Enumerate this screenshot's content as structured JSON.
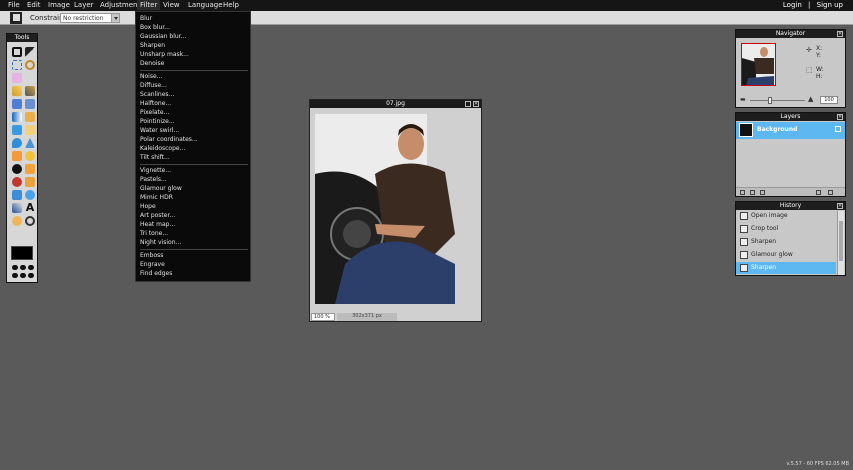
{
  "menubar": {
    "items": [
      "File",
      "Edit",
      "Image",
      "Layer",
      "Adjustment",
      "Filter",
      "View",
      "Language",
      "Help"
    ],
    "login": "Login",
    "separator": "|",
    "signup": "Sign up"
  },
  "toolbar": {
    "constraint_label": "Constraint:",
    "constraint_value": "No restriction"
  },
  "filter_menu": {
    "groups": [
      [
        "Blur",
        "Box blur...",
        "Gaussian blur...",
        "Sharpen",
        "Unsharp mask...",
        "Denoise"
      ],
      [
        "Noise...",
        "Diffuse...",
        "Scanlines...",
        "Halftone...",
        "Pixelate...",
        "Pointinize...",
        "Water swirl...",
        "Polar coordinates...",
        "Kaleidoscope...",
        "Tilt shift..."
      ],
      [
        "Vignette...",
        "Pastels...",
        "Glamour glow",
        "Mimic HDR",
        "Hope",
        "Art poster...",
        "Heat map...",
        "Tri tone...",
        "Night vision..."
      ],
      [
        "Emboss",
        "Engrave",
        "Find edges"
      ]
    ]
  },
  "tools_panel": {
    "title": "Tools"
  },
  "image_window": {
    "title": "07.jpg",
    "zoom": "100 %",
    "size": "302x371 px"
  },
  "navigator": {
    "title": "Navigator",
    "x_label": "X:",
    "y_label": "Y:",
    "w_label": "W:",
    "h_label": "H:",
    "zoom_value": "100"
  },
  "layers": {
    "title": "Layers",
    "items": [
      {
        "name": "Background"
      }
    ]
  },
  "history": {
    "title": "History",
    "items": [
      "Open image",
      "Crop tool",
      "Sharpen",
      "Glamour glow",
      "Sharpen"
    ]
  },
  "status": {
    "fps": "v.5.57 - 60 FPS 62.05 MB"
  },
  "colors": {
    "selection_blue": "#5db8f2",
    "menubar_bg": "#151515",
    "workspace_bg": "#5a5a5a"
  }
}
